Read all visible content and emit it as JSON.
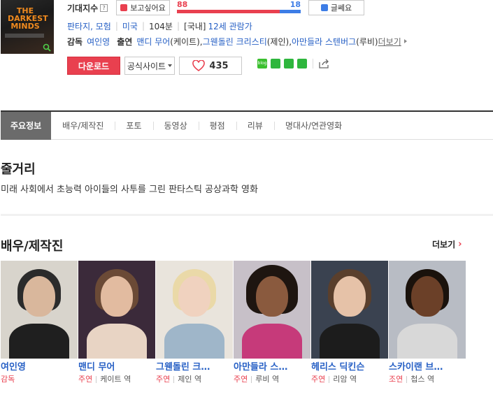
{
  "movie": {
    "poster": {
      "title_text": "THE DARKEST MINDS"
    },
    "anticipation_label": "기대지수",
    "help_icon": "?",
    "want_button": "보고싶어요",
    "dislike_button": "글쎄요",
    "gauge": {
      "want": "88",
      "dislike": "18",
      "want_fraction": 0.83
    },
    "genre": "판타지, 모험",
    "country": "미국",
    "runtime": "104분",
    "rating_prefix": "[국내]",
    "rating": "12세 관람가",
    "director_label": "감독",
    "director": "여인영",
    "cast_label": "출연",
    "cast_line": [
      {
        "name": "맨디 무어",
        "role": "(케이트), "
      },
      {
        "name": "그웬돌린 크리스티",
        "role": "(제인), "
      },
      {
        "name": "아만들라 스텐버그",
        "role": "(루비)"
      }
    ],
    "more_label": "더보기",
    "download_button": "다운로드",
    "official_site_button": "공식사이트",
    "like_count": "435",
    "share_icons": [
      "blog-icon",
      "cafe-icon",
      "bookmark-icon",
      "memo-icon",
      "share-icon"
    ]
  },
  "tabs": [
    {
      "label": "주요정보",
      "active": true
    },
    {
      "label": "배우/제작진"
    },
    {
      "label": "포토"
    },
    {
      "label": "동영상"
    },
    {
      "label": "평점"
    },
    {
      "label": "리뷰"
    },
    {
      "label": "명대사/연관영화"
    }
  ],
  "synopsis": {
    "title": "줄거리",
    "text": "미래 사회에서 초능력 아이들의 사투를 그린 판타스틱 공상과학 영화"
  },
  "cast_section": {
    "title": "배우/제작진",
    "more": "더보기",
    "members": [
      {
        "name": "여인영",
        "role": "감독",
        "character": ""
      },
      {
        "name": "맨디 무어",
        "role": "주연",
        "character": "케이트 역"
      },
      {
        "name": "그웬돌린 크…",
        "role": "주연",
        "character": "제인 역"
      },
      {
        "name": "아만들라 스…",
        "role": "주연",
        "character": "루비 역"
      },
      {
        "name": "헤리스 딕킨슨",
        "role": "주연",
        "character": "리암 역"
      },
      {
        "name": "스카이랜 브…",
        "role": "조연",
        "character": "첩스 역"
      }
    ]
  },
  "colors": {
    "accent": "#e9404f",
    "link": "#2760c5",
    "blue": "#3d7de6"
  }
}
